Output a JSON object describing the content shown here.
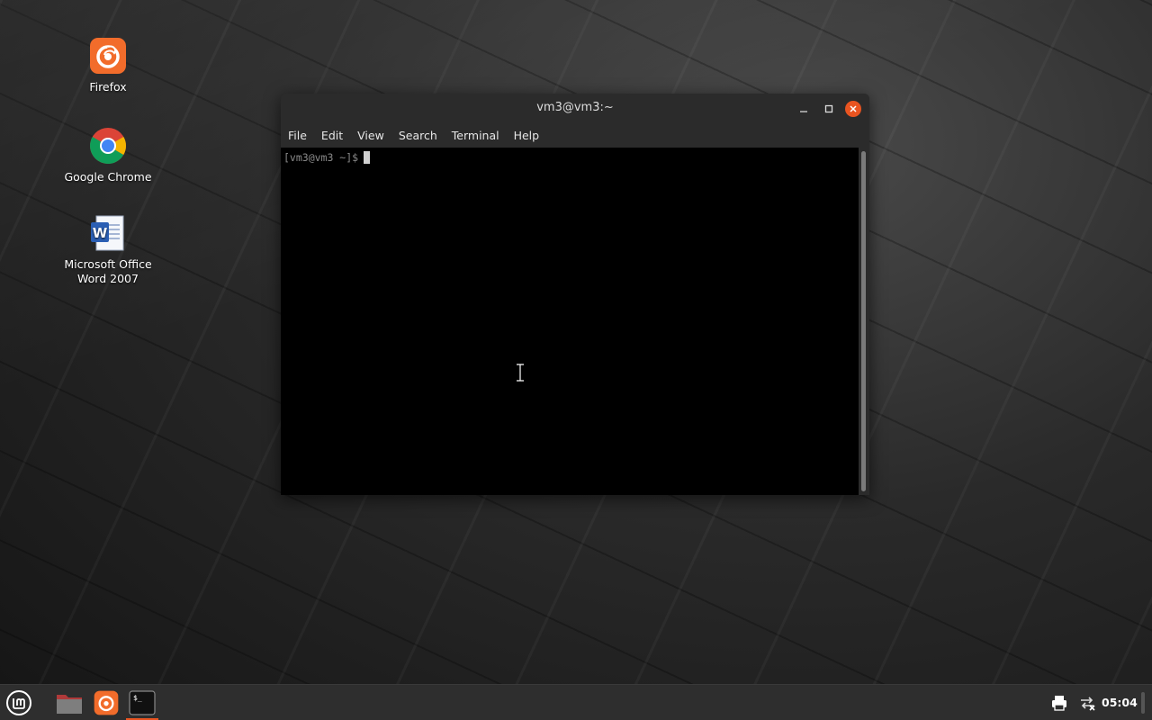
{
  "desktop": {
    "icons": [
      {
        "label": "Firefox",
        "icon": "firefox-icon"
      },
      {
        "label": "Google Chrome",
        "icon": "chrome-icon"
      },
      {
        "label_line1": "Microsoft Office",
        "label_line2": "Word 2007",
        "icon": "word-icon"
      }
    ]
  },
  "terminal": {
    "title": "vm3@vm3:~",
    "menu": [
      "File",
      "Edit",
      "View",
      "Search",
      "Terminal",
      "Help"
    ],
    "prompt": "[vm3@vm3 ~]$"
  },
  "taskbar": {
    "clock": "05:04",
    "launchers": [
      "mint-menu-icon",
      "files-folder-icon",
      "firefox-icon",
      "terminal-icon"
    ],
    "tray": [
      "printer-icon",
      "network-disconnected-icon"
    ]
  },
  "colors": {
    "accent": "#e95420",
    "window_bg": "#2b2b2b",
    "taskbar_bg": "#2e2e2e"
  }
}
